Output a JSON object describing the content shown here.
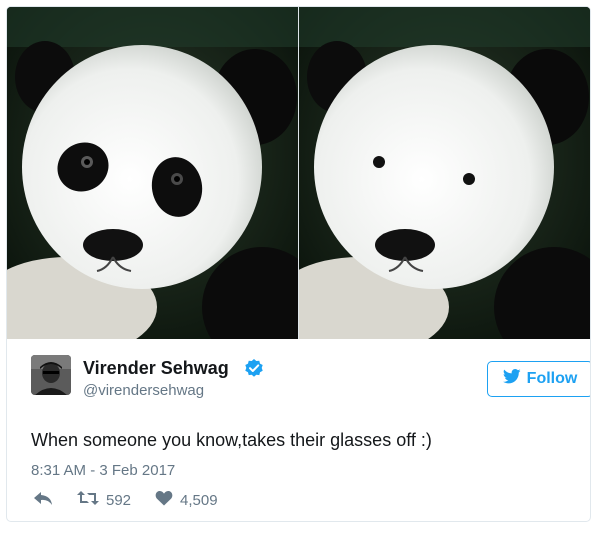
{
  "media": {
    "left_image": "panda-with-eye-patches",
    "right_image": "panda-without-eye-patches"
  },
  "author": {
    "name": "Virender Sehwag",
    "handle": "@virendersehwag",
    "verified": true,
    "verified_icon": "verified-badge-icon"
  },
  "follow_button": {
    "label": "Follow",
    "icon": "twitter-bird-icon"
  },
  "tweet": {
    "text": "When someone you know,takes their glasses off :)",
    "timestamp": "8:31 AM - 3 Feb 2017"
  },
  "actions": {
    "reply_icon": "reply-icon",
    "retweet_icon": "retweet-icon",
    "retweet_count": "592",
    "like_icon": "heart-icon",
    "like_count": "4,509"
  },
  "colors": {
    "accent": "#1da1f2",
    "secondary_text": "#657786",
    "border": "#e1e8ed"
  }
}
